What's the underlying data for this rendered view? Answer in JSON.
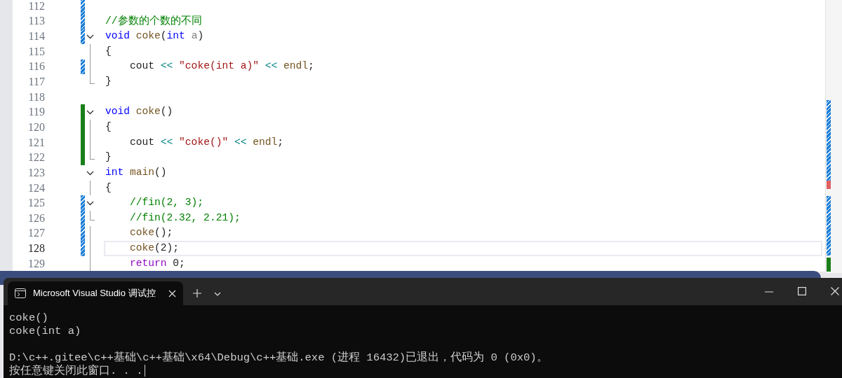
{
  "editor": {
    "lines": [
      {
        "number": "112",
        "unsaved_change": true,
        "saved_change": false,
        "collapsible": false,
        "in_block": false,
        "block_end": false,
        "current": false
      },
      {
        "number": "113",
        "unsaved_change": true,
        "saved_change": false,
        "collapsible": false,
        "in_block": false,
        "block_end": false,
        "current": false,
        "tokens": [
          {
            "kind": "comment",
            "t": "//参数的个数的不同"
          }
        ]
      },
      {
        "number": "114",
        "unsaved_change": true,
        "saved_change": false,
        "collapsible": true,
        "in_block": false,
        "block_end": false,
        "current": false,
        "tokens": [
          {
            "kind": "keyword",
            "t": "void "
          },
          {
            "kind": "func",
            "t": "coke"
          },
          {
            "kind": "plain",
            "t": "("
          },
          {
            "kind": "keyword",
            "t": "int "
          },
          {
            "kind": "param",
            "t": "a"
          },
          {
            "kind": "plain",
            "t": ")"
          }
        ]
      },
      {
        "number": "115",
        "unsaved_change": false,
        "saved_change": false,
        "collapsible": false,
        "in_block": true,
        "block_end": false,
        "current": false,
        "tokens": [
          {
            "kind": "plain",
            "t": "{"
          }
        ]
      },
      {
        "number": "116",
        "unsaved_change": true,
        "saved_change": false,
        "collapsible": false,
        "in_block": true,
        "block_end": false,
        "current": false,
        "tokens": [
          {
            "kind": "plain",
            "t": "    cout "
          },
          {
            "kind": "op",
            "t": "<< "
          },
          {
            "kind": "string",
            "t": "\"coke(int a)\""
          },
          {
            "kind": "op",
            "t": " << "
          },
          {
            "kind": "func",
            "t": "endl"
          },
          {
            "kind": "plain",
            "t": ";"
          }
        ]
      },
      {
        "number": "117",
        "unsaved_change": false,
        "saved_change": false,
        "collapsible": false,
        "in_block": true,
        "block_end": true,
        "current": false,
        "tokens": [
          {
            "kind": "plain",
            "t": "}"
          }
        ]
      },
      {
        "number": "118",
        "unsaved_change": false,
        "saved_change": false,
        "collapsible": false,
        "in_block": false,
        "block_end": false,
        "current": false
      },
      {
        "number": "119",
        "unsaved_change": false,
        "saved_change": true,
        "collapsible": true,
        "in_block": false,
        "block_end": false,
        "current": false,
        "tokens": [
          {
            "kind": "keyword",
            "t": "void "
          },
          {
            "kind": "func",
            "t": "coke"
          },
          {
            "kind": "plain",
            "t": "()"
          }
        ]
      },
      {
        "number": "120",
        "unsaved_change": false,
        "saved_change": true,
        "collapsible": false,
        "in_block": true,
        "block_end": false,
        "current": false,
        "tokens": [
          {
            "kind": "plain",
            "t": "{"
          }
        ]
      },
      {
        "number": "121",
        "unsaved_change": false,
        "saved_change": true,
        "collapsible": false,
        "in_block": true,
        "block_end": false,
        "current": false,
        "tokens": [
          {
            "kind": "plain",
            "t": "    cout "
          },
          {
            "kind": "op",
            "t": "<< "
          },
          {
            "kind": "string",
            "t": "\"coke()\""
          },
          {
            "kind": "op",
            "t": " << "
          },
          {
            "kind": "func",
            "t": "endl"
          },
          {
            "kind": "plain",
            "t": ";"
          }
        ]
      },
      {
        "number": "122",
        "unsaved_change": false,
        "saved_change": true,
        "collapsible": false,
        "in_block": true,
        "block_end": true,
        "current": false,
        "tokens": [
          {
            "kind": "plain",
            "t": "}"
          }
        ]
      },
      {
        "number": "123",
        "unsaved_change": false,
        "saved_change": false,
        "collapsible": true,
        "in_block": false,
        "block_end": false,
        "current": false,
        "tokens": [
          {
            "kind": "keyword",
            "t": "int "
          },
          {
            "kind": "func",
            "t": "main"
          },
          {
            "kind": "plain",
            "t": "()"
          }
        ]
      },
      {
        "number": "124",
        "unsaved_change": false,
        "saved_change": false,
        "collapsible": false,
        "in_block": true,
        "block_end": false,
        "current": false,
        "tokens": [
          {
            "kind": "plain",
            "t": "{"
          }
        ]
      },
      {
        "number": "125",
        "unsaved_change": true,
        "saved_change": false,
        "collapsible": true,
        "in_block": false,
        "block_end": false,
        "current": false,
        "tokens": [
          {
            "kind": "comment",
            "t": "    //fin(2, 3);"
          }
        ]
      },
      {
        "number": "126",
        "unsaved_change": true,
        "saved_change": false,
        "collapsible": false,
        "in_block": true,
        "block_end": true,
        "current": false,
        "tokens": [
          {
            "kind": "comment",
            "t": "    //fin(2.32, 2.21);"
          }
        ]
      },
      {
        "number": "127",
        "unsaved_change": true,
        "saved_change": false,
        "collapsible": false,
        "in_block": true,
        "block_end": false,
        "current": false,
        "tokens": [
          {
            "kind": "func",
            "t": "    coke"
          },
          {
            "kind": "plain",
            "t": "();"
          }
        ]
      },
      {
        "number": "128",
        "unsaved_change": true,
        "saved_change": false,
        "collapsible": false,
        "in_block": true,
        "block_end": false,
        "current": true,
        "tokens": [
          {
            "kind": "func",
            "t": "    coke"
          },
          {
            "kind": "plain",
            "t": "(2);"
          }
        ]
      },
      {
        "number": "129",
        "unsaved_change": false,
        "saved_change": false,
        "collapsible": false,
        "in_block": true,
        "block_end": false,
        "current": false,
        "tokens": [
          {
            "kind": "keyword2",
            "t": "    return"
          },
          {
            "kind": "plain",
            "t": " 0;"
          }
        ]
      }
    ]
  },
  "console": {
    "tab": {
      "title": "Microsoft Visual Studio 调试控",
      "selected": true
    },
    "output": [
      "coke()",
      "coke(int a)"
    ],
    "exit_message": [
      "D:\\c++.gitee\\c++基础\\c++基础\\x64\\Debug\\c++基础.exe (进程 16432)已退出，代码为 0 (0x0)。",
      "按任意键关闭此窗口. . ."
    ]
  }
}
